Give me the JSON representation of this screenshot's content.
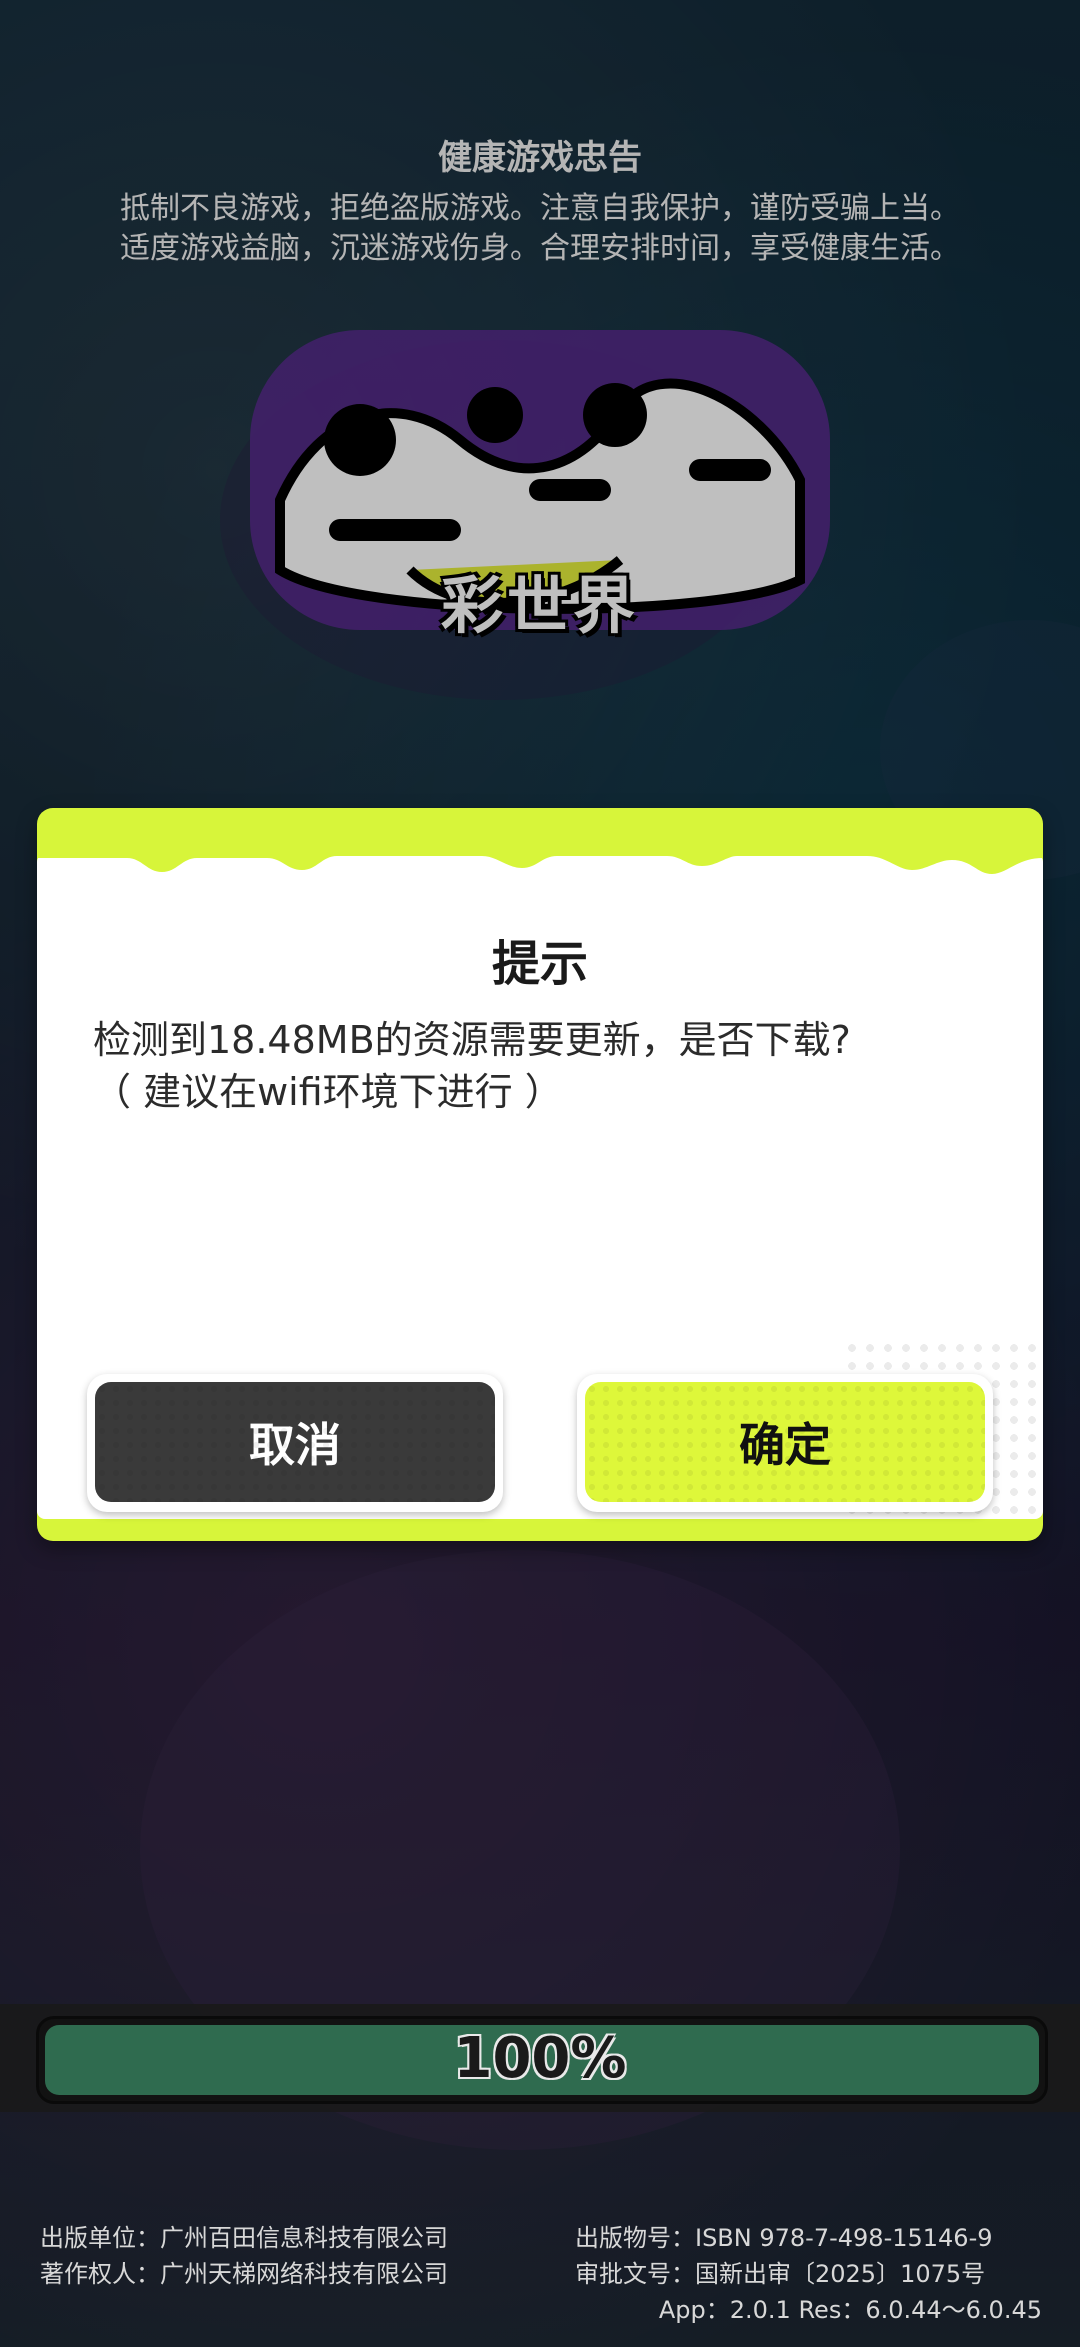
{
  "health_notice": {
    "title": "健康游戏忠告",
    "line1": "抵制不良游戏，拒绝盗版游戏。注意自我保护，谨防受骗上当。",
    "line2": "适度游戏益脑，沉迷游戏伤身。合理安排时间，享受健康生活。"
  },
  "logo": {
    "name_icon": "game-logo-icon",
    "subtitle": "彩世界"
  },
  "dialog": {
    "title": "提示",
    "message_line1": "检测到18.48MB的资源需要更新，是否下载?",
    "message_line2": "（ 建议在wifi环境下进行 ）",
    "cancel_label": "取消",
    "confirm_label": "确定"
  },
  "progress": {
    "percent": 100,
    "label": "100%"
  },
  "footer": {
    "publisher": "出版单位：广州百田信息科技有限公司",
    "copyright": "著作权人：广州天梯网络科技有限公司",
    "isbn": "出版物号：ISBN 978-7-498-15146-9",
    "approval": "审批文号：国新出审〔2025〕1075号",
    "version": "App：2.0.1  Res：6.0.44～6.0.45"
  },
  "colors": {
    "accent_lime": "#d7f53a",
    "dark_button": "#3a3a3a",
    "progress_green": "#2f6b4f"
  }
}
